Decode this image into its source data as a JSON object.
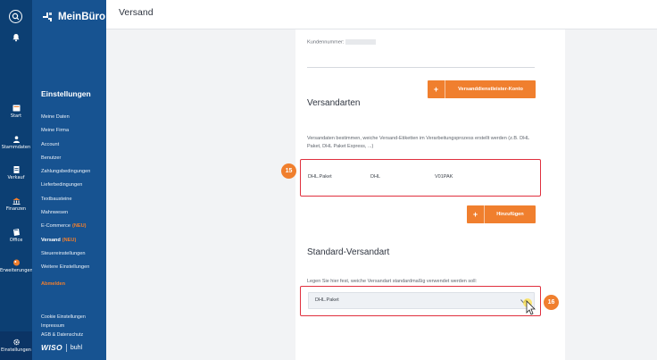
{
  "rail": {
    "items": [
      {
        "label": "Start",
        "icon": "start-icon"
      },
      {
        "label": "Stammdaten",
        "icon": "person-icon"
      },
      {
        "label": "Verkauf",
        "icon": "document-icon"
      },
      {
        "label": "Finanzen",
        "icon": "bank-icon"
      },
      {
        "label": "Office",
        "icon": "office-icon"
      },
      {
        "label": "Erweiterungen",
        "icon": "puzzle-icon"
      },
      {
        "label": "Einstellungen",
        "icon": "gear-icon"
      }
    ]
  },
  "nav": {
    "brand": "MeinBüro",
    "title": "Einstellungen",
    "items": [
      {
        "label": "Meine Daten"
      },
      {
        "label": "Meine Firma"
      },
      {
        "label": "Account"
      },
      {
        "label": "Benutzer"
      },
      {
        "label": "Zahlungsbedingungen"
      },
      {
        "label": "Lieferbedingungen"
      },
      {
        "label": "Textbausteine"
      },
      {
        "label": "Mahnwesen"
      },
      {
        "label": "E-Commerce",
        "badge": "(NEU)"
      },
      {
        "label": "Versand",
        "badge": "(NEU)"
      },
      {
        "label": "Steuereinstellungen"
      },
      {
        "label": "Weitere Einstellungen"
      }
    ],
    "logout": "Abmelden",
    "footer": [
      "Cookie Einstellungen",
      "Impressum",
      "AGB & Datenschutz"
    ],
    "brand_left": "WISO",
    "brand_right": "buhl"
  },
  "header": {
    "title": "Versand"
  },
  "content": {
    "customer_number_label": "Kundennummer:",
    "provider_button": "Versanddienstleister-Konto",
    "methods_heading": "Versandarten",
    "methods_desc": "Versandaten bestimmen, weiche Versand-Etiketten im Verarbeitungsprozess erstellt werden (z.B. DHL Paket, DHL Paket Express, ...)",
    "method_row": {
      "name": "DHL.Paket",
      "carrier": "DHL",
      "code": "V01PAK"
    },
    "add_button": "Hinzufügen",
    "std_heading": "Standard-Versandart",
    "std_desc": "Legen Sie hier fest, weiche Versandart standardmaßig verwendet werden soll:",
    "std_value": "DHL.Paket",
    "badge_methods": "15",
    "badge_std": "16"
  },
  "colors": {
    "accent": "#f07f2e",
    "nav": "#175391",
    "rail": "#0c3f73",
    "highlight": "#e0303e"
  }
}
